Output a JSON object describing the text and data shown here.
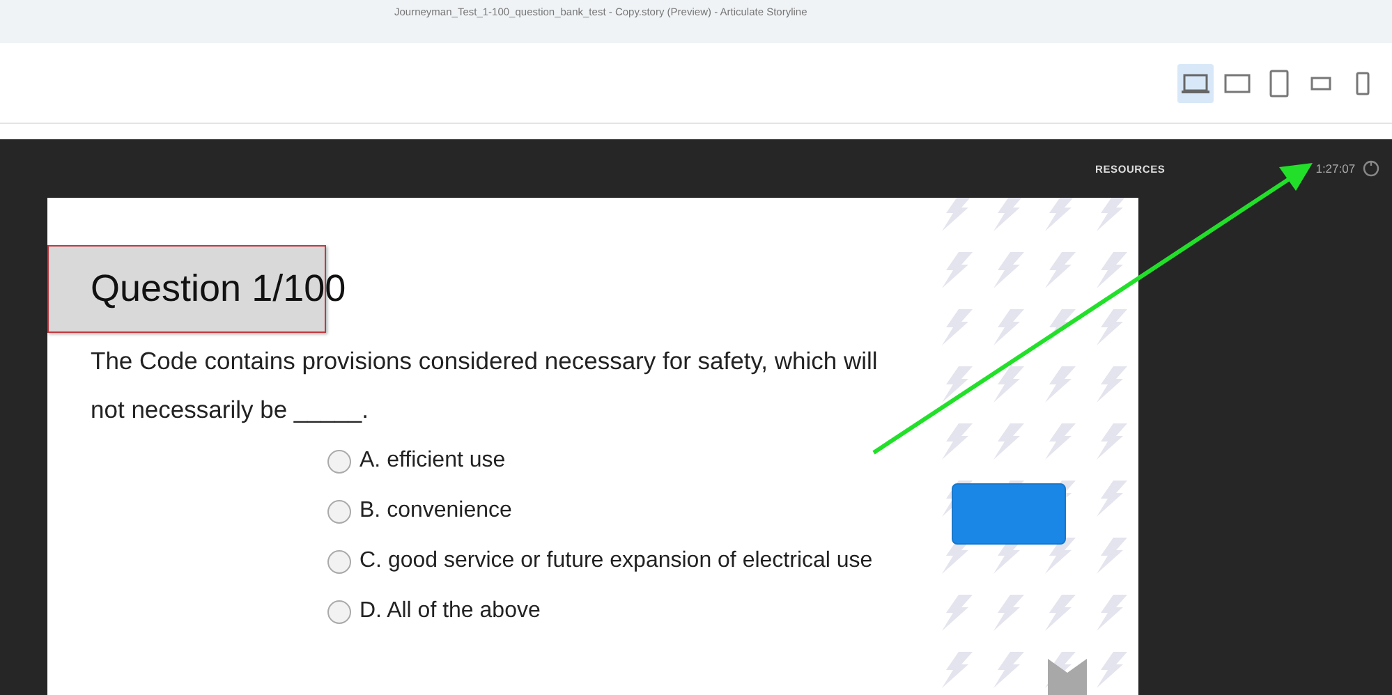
{
  "window": {
    "title": "Journeyman_Test_1-100_question_bank_test - Copy.story (Preview) -  Articulate Storyline"
  },
  "toolbar": {
    "devices": [
      {
        "kind": "laptop",
        "selected": true
      },
      {
        "kind": "tablet-landscape",
        "selected": false
      },
      {
        "kind": "tablet-portrait",
        "selected": false
      },
      {
        "kind": "phone-landscape",
        "selected": false
      },
      {
        "kind": "phone-portrait",
        "selected": false
      }
    ]
  },
  "player": {
    "resources_label": "RESOURCES",
    "timer": "1:27:07"
  },
  "slide": {
    "question_title": "Question 1/100",
    "question_text": "The Code contains provisions considered necessary for safety, which will not necessarily be _____.",
    "options": [
      {
        "label": "A. efficient use",
        "selected": false
      },
      {
        "label": "B. convenience",
        "selected": false
      },
      {
        "label": "C. good service or future expansion of electrical use",
        "selected": false
      },
      {
        "label": "D. All of the above",
        "selected": false
      }
    ]
  }
}
